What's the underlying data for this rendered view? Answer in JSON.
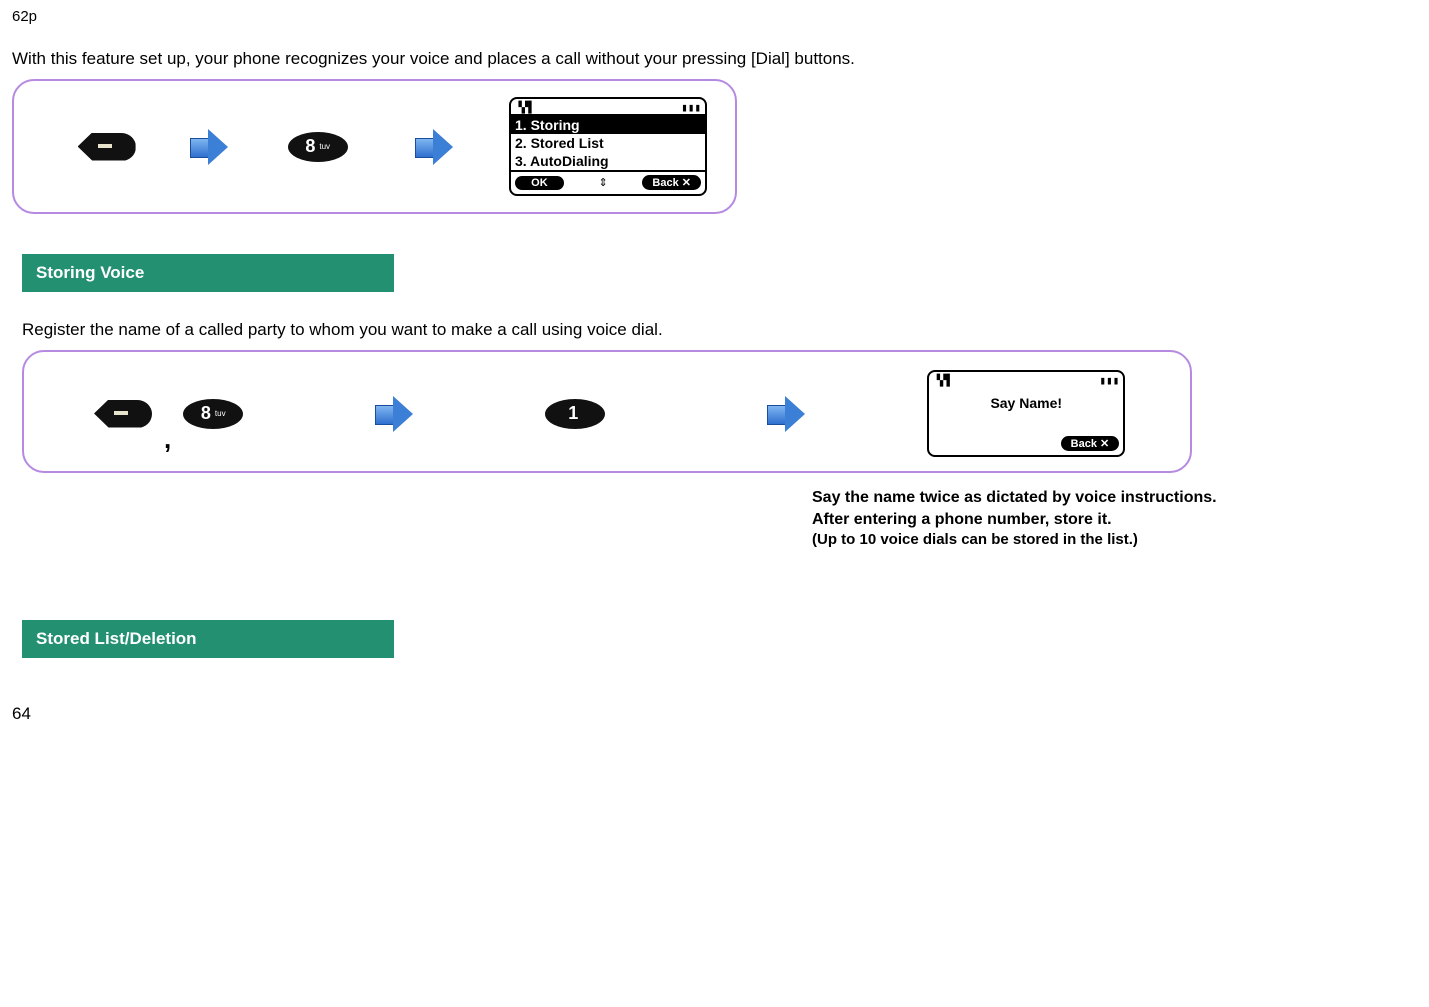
{
  "top_page_label": "62p",
  "intro": "With this feature set up, your phone recognizes your voice and places a call without your pressing [Dial] buttons.",
  "keypad": {
    "eight": {
      "digit": "8",
      "sub": "tuv"
    },
    "one": {
      "digit": "1",
      "sub": ""
    }
  },
  "screen1": {
    "menu": [
      "1. Storing",
      "2. Stored List",
      "3. AutoDialing"
    ],
    "soft_left": "OK",
    "soft_right": "Back"
  },
  "section_storing": {
    "header": "Storing Voice",
    "description": "Register the name of a called party to whom you want to make a call using voice dial."
  },
  "screen2": {
    "title": "Say Name!",
    "soft_right": "Back"
  },
  "tip": {
    "line1": "Say the name twice as dictated by voice instructions.",
    "line2": "After entering a phone number, store it.",
    "limit": "(Up to 10 voice dials can be stored in the list.)"
  },
  "section_stored_list": {
    "header": "Stored List/Deletion"
  },
  "page_number": "64"
}
